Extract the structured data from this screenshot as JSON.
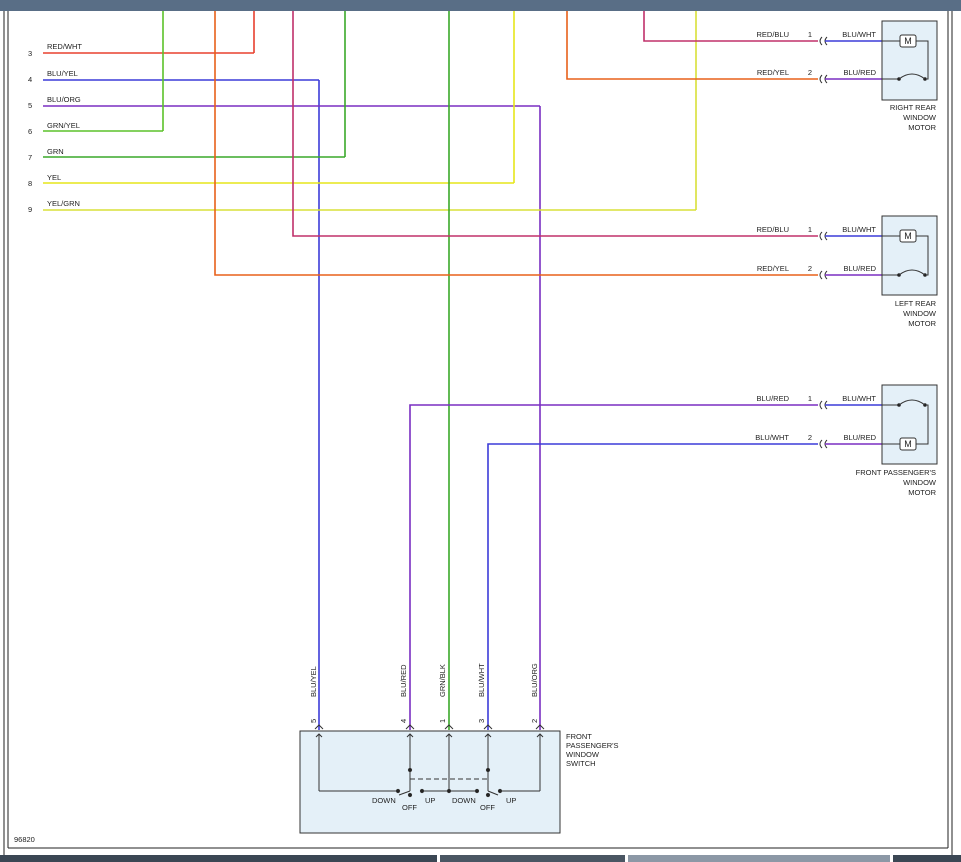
{
  "diagram_id": "96820",
  "colors": {
    "RED": "#e8402e",
    "ORG": "#e8601a",
    "BLU": "#3c3cd8",
    "PUR": "#7a2ec2",
    "GRN": "#3aa82a",
    "GRN_LT": "#5cc22a",
    "YEL": "#e6e61a",
    "YEL_GRN": "#d8e038",
    "MAGENTA": "#c0306a",
    "BOX": "#e4f0f8"
  },
  "left_wires": [
    {
      "pin": "3",
      "label": "RED/WHT"
    },
    {
      "pin": "4",
      "label": "BLU/YEL"
    },
    {
      "pin": "5",
      "label": "BLU/ORG"
    },
    {
      "pin": "6",
      "label": "GRN/YEL"
    },
    {
      "pin": "7",
      "label": "GRN"
    },
    {
      "pin": "8",
      "label": "YEL"
    },
    {
      "pin": "9",
      "label": "YEL/GRN"
    }
  ],
  "motors": [
    {
      "name_lines": [
        "RIGHT REAR",
        "WINDOW",
        "MOTOR"
      ],
      "pins": [
        {
          "pin": "1",
          "harness_label": "RED/BLU",
          "motor_label": "BLU/WHT"
        },
        {
          "pin": "2",
          "harness_label": "RED/YEL",
          "motor_label": "BLU/RED"
        }
      ]
    },
    {
      "name_lines": [
        "LEFT REAR",
        "WINDOW",
        "MOTOR"
      ],
      "pins": [
        {
          "pin": "1",
          "harness_label": "RED/BLU",
          "motor_label": "BLU/WHT"
        },
        {
          "pin": "2",
          "harness_label": "RED/YEL",
          "motor_label": "BLU/RED"
        }
      ]
    },
    {
      "name_lines": [
        "FRONT PASSENGER'S",
        "WINDOW",
        "MOTOR"
      ],
      "pins": [
        {
          "pin": "1",
          "harness_label": "BLU/RED",
          "motor_label": "BLU/WHT"
        },
        {
          "pin": "2",
          "harness_label": "BLU/WHT",
          "motor_label": "BLU/RED"
        }
      ]
    }
  ],
  "motor_symbol": "M",
  "switch": {
    "name_lines": [
      "FRONT",
      "PASSENGER'S",
      "WINDOW",
      "SWITCH"
    ],
    "pins": [
      {
        "pin": "5",
        "label": "BLU/YEL"
      },
      {
        "pin": "4",
        "label": "BLU/RED"
      },
      {
        "pin": "1",
        "label": "GRN/BLK"
      },
      {
        "pin": "3",
        "label": "BLU/WHT"
      },
      {
        "pin": "2",
        "label": "BLU/ORG"
      }
    ],
    "positions": [
      "DOWN",
      "OFF",
      "UP",
      "DOWN",
      "OFF",
      "UP"
    ]
  }
}
